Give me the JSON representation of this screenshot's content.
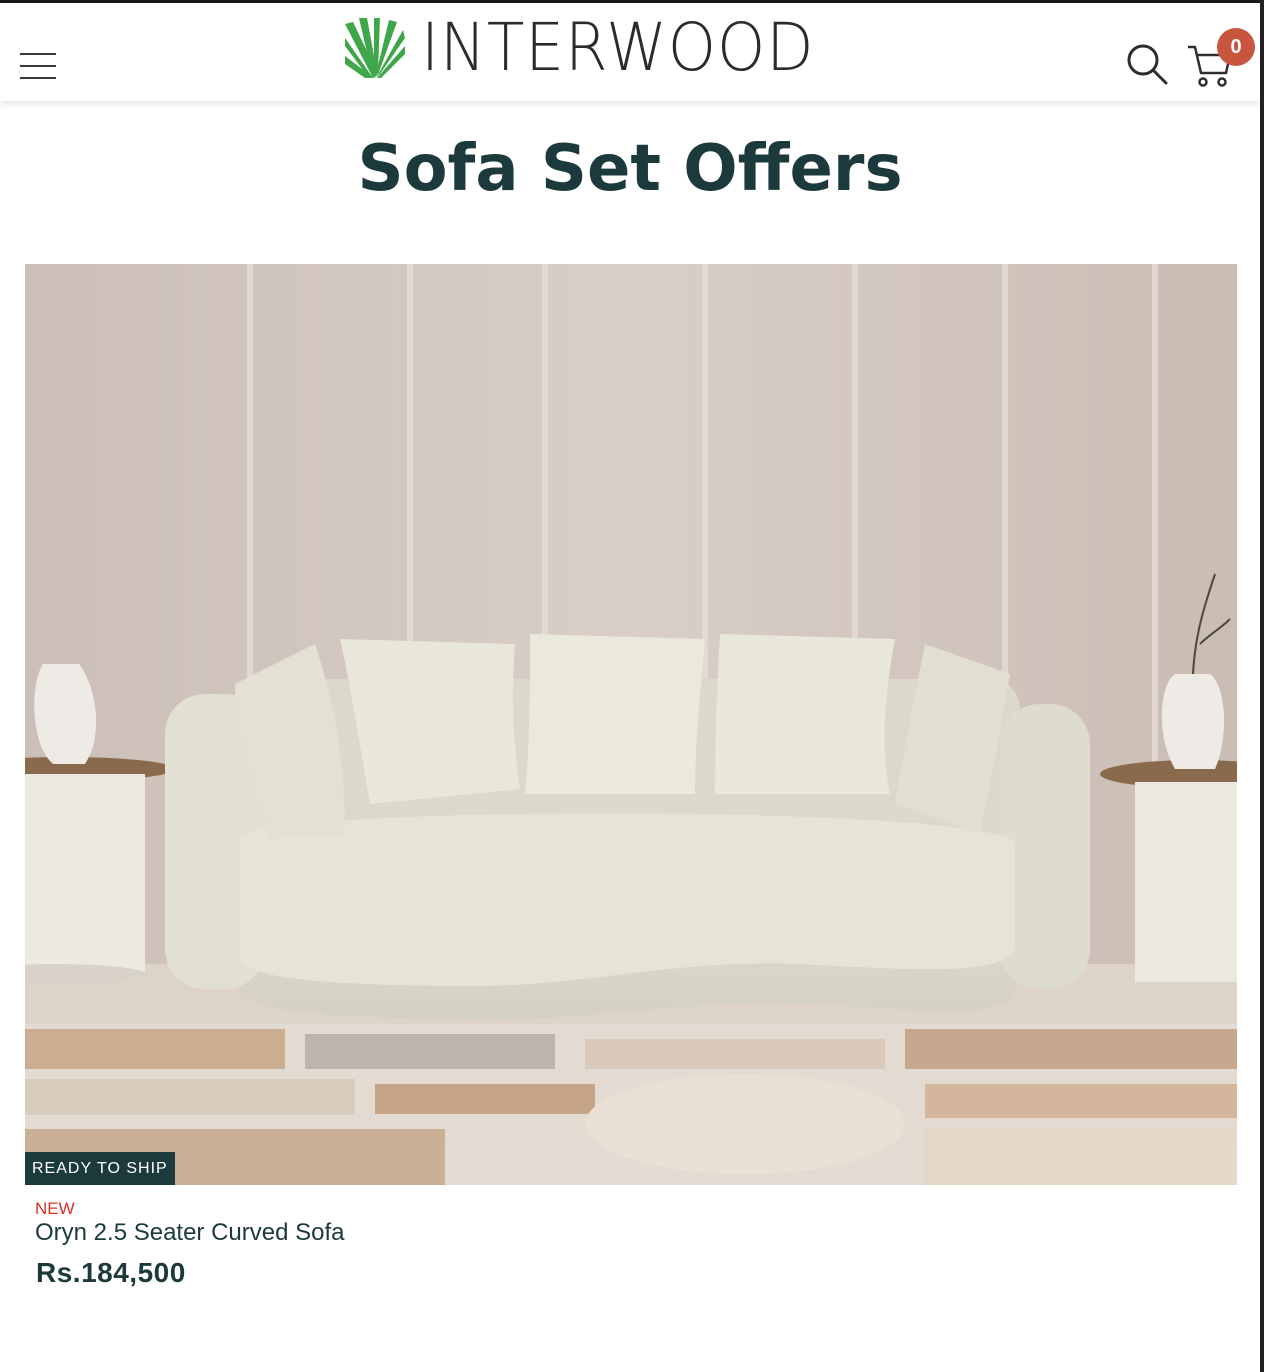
{
  "header": {
    "logo_text": "INTERWOOD",
    "cart_count": "0",
    "icons": [
      "menu-icon",
      "search-icon",
      "cart-icon"
    ]
  },
  "page": {
    "title": "Sofa Set Offers"
  },
  "product": {
    "badge": "READY TO SHIP",
    "tag": "NEW",
    "name": "Oryn 2.5 Seater Curved Sofa",
    "price": "Rs.184,500"
  },
  "colors": {
    "brand_dark": "#1c3a3c",
    "badge_red": "#c8553d",
    "new_red": "#d93025",
    "logo_green": "#3fa64a"
  }
}
